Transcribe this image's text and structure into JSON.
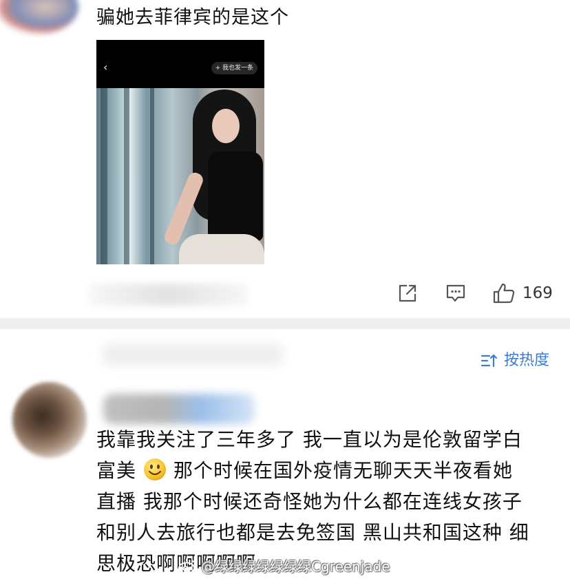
{
  "comment_1": {
    "text": "骗她去菲律宾的是这个",
    "photo": {
      "back_icon": "chevron-left-icon",
      "send_label": "+ 我也发一条"
    },
    "actions": {
      "share_icon": "share-icon",
      "reply_icon": "comment-icon",
      "like_icon": "thumbs-up-icon",
      "like_count": "169"
    }
  },
  "sort": {
    "icon": "sort-icon",
    "label": "按热度"
  },
  "comment_2": {
    "line_1": "我靠我关注了三年多了 我一直以为是伦敦留学白",
    "line_2_before_emoji": "富美",
    "emoji": "smile-emoji",
    "line_2_after_emoji": "那个时候在国外疫情无聊天天半夜看她",
    "line_3": "直播 我那个时候还奇怪她为什么都在连线女孩子",
    "line_4": "和别人去旅行也都是去免签国 黑山共和国这种 细",
    "line_5": "思极恐啊啊啊啊啊"
  },
  "watermark": {
    "text": "@绿绿绿绿绿绿绿Cgreenjade"
  },
  "colors": {
    "accent": "#3b7bd6",
    "divider": "#efefef",
    "text": "#111111"
  }
}
